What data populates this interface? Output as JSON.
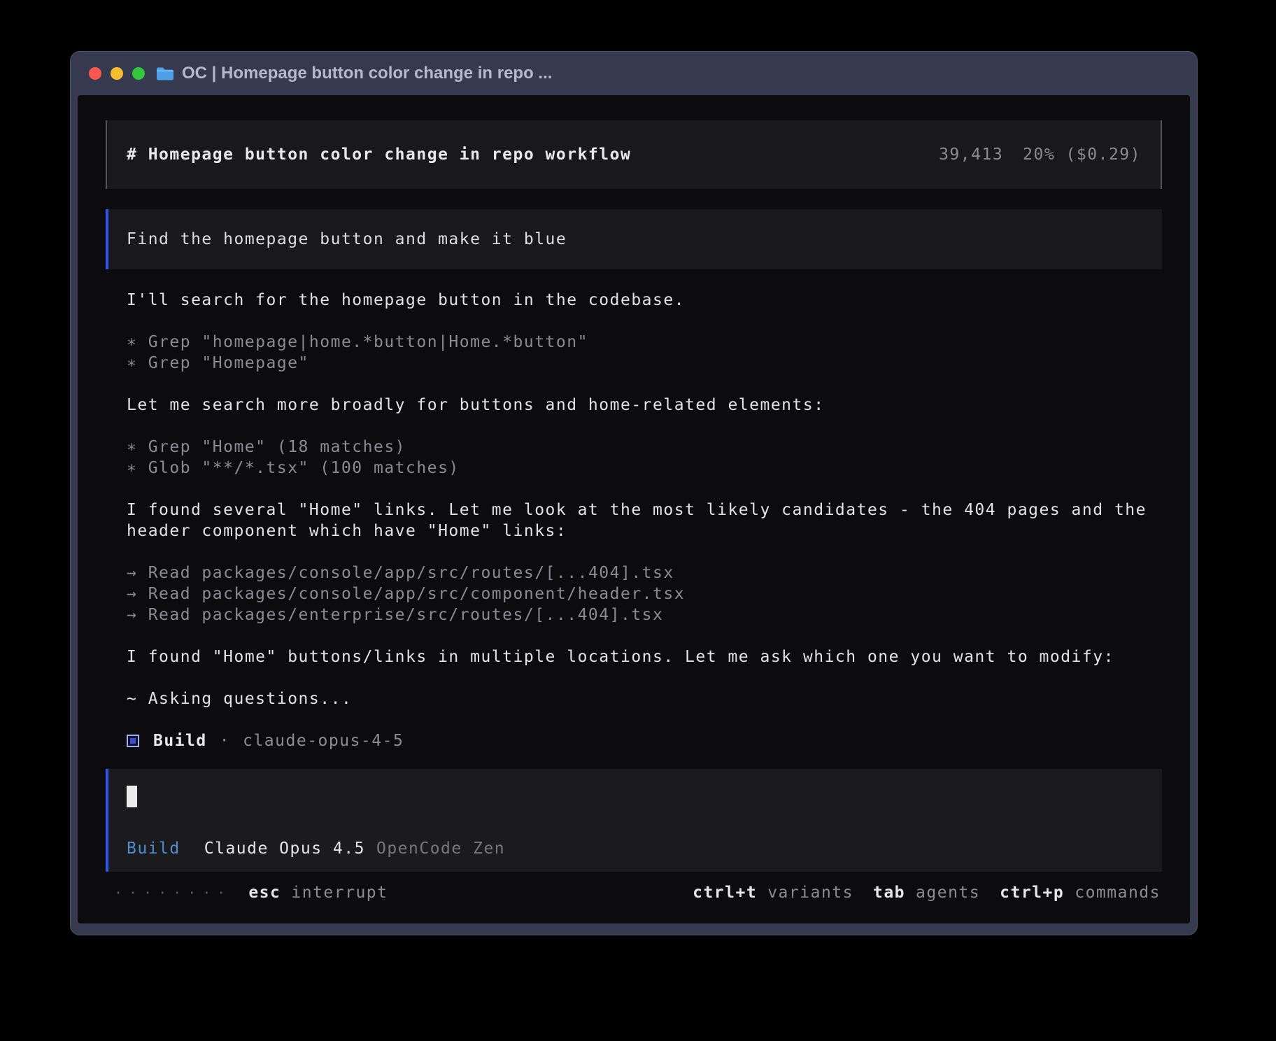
{
  "titlebar": {
    "title": "OC | Homepage button color change in repo ..."
  },
  "header": {
    "title": "# Homepage button color change in repo workflow",
    "tokens": "39,413",
    "usage": "20% ($0.29)"
  },
  "user_message": {
    "text": "Find the homepage button and make it blue"
  },
  "transcript": {
    "msg1": "I'll search for the homepage button in the codebase.",
    "tool1": "∗ Grep \"homepage|home.*button|Home.*button\"",
    "tool2": "∗ Grep \"Homepage\"",
    "msg2": "Let me search more broadly for buttons and home-related elements:",
    "tool3": "∗ Grep \"Home\" (18 matches)",
    "tool4": "∗ Glob \"**/*.tsx\" (100 matches)",
    "msg3": "I found several \"Home\" links. Let me look at the most likely candidates - the 404 pages and the header component which have \"Home\" links:",
    "tool5": "→ Read packages/console/app/src/routes/[...404].tsx",
    "tool6": "→ Read packages/console/app/src/component/header.tsx",
    "tool7": "→ Read packages/enterprise/src/routes/[...404].tsx",
    "msg4": "I found \"Home\" buttons/links in multiple locations. Let me ask which one you want to modify:",
    "status": "~ Asking questions...",
    "agent": {
      "name": "Build",
      "sep": "·",
      "model": "claude-opus-4-5"
    }
  },
  "input": {
    "mode": "Build",
    "model": "Claude Opus 4.5",
    "provider": "OpenCode Zen"
  },
  "statusbar": {
    "spinner": "········",
    "esc": {
      "key": "esc",
      "label": "interrupt"
    },
    "shortcuts": [
      {
        "key": "ctrl+t",
        "label": "variants"
      },
      {
        "key": "tab",
        "label": "agents"
      },
      {
        "key": "ctrl+p",
        "label": "commands"
      }
    ]
  },
  "colors": {
    "accent_border_blue": "#2e55ee",
    "mode_blue": "#4e8ed3",
    "traffic_red": "#f8564f",
    "traffic_yellow": "#f7bd2e",
    "traffic_green": "#32c73c",
    "folder_blue": "#4da0e8"
  }
}
